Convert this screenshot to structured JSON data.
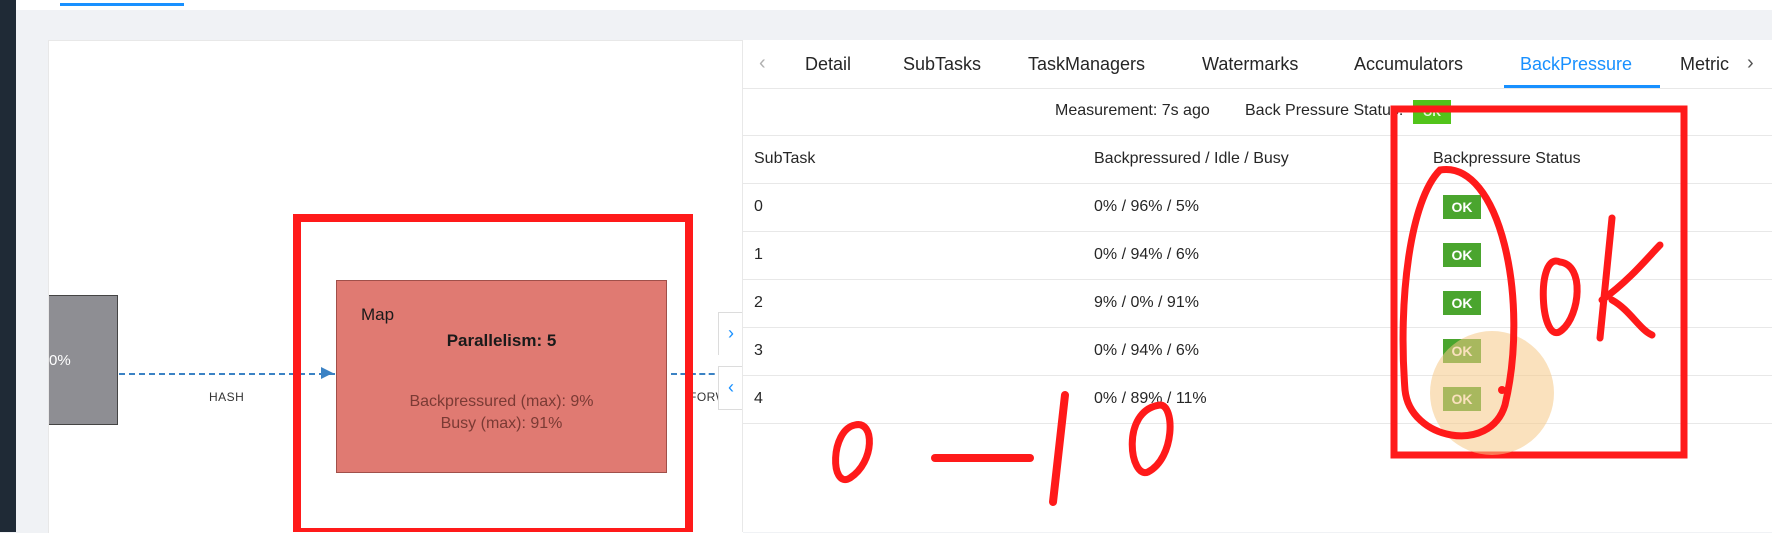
{
  "graph": {
    "source_node": {
      "percent": "0%"
    },
    "edges": {
      "left_label": "HASH",
      "right_label": "FORW"
    },
    "map_node": {
      "name": "Map",
      "parallelism": "Parallelism: 5",
      "backpressured": "Backpressured (max): 9%",
      "busy": "Busy (max): 91%"
    },
    "collapse_buttons": {
      "up": "›",
      "down": "‹"
    }
  },
  "tabs": {
    "prev_arrow": "‹",
    "next_arrow": "›",
    "items": [
      {
        "label": "Detail"
      },
      {
        "label": "SubTasks"
      },
      {
        "label": "TaskManagers"
      },
      {
        "label": "Watermarks"
      },
      {
        "label": "Accumulators"
      },
      {
        "label": "BackPressure",
        "active": true
      },
      {
        "label": "Metric"
      }
    ]
  },
  "measurement": {
    "text": "Measurement: 7s ago",
    "status_label": "Back Pressure Status:",
    "status_value": "OK"
  },
  "table": {
    "headers": [
      "SubTask",
      "Backpressured / Idle / Busy",
      "Backpressure Status"
    ],
    "rows": [
      {
        "subtask": "0",
        "ratio": "0% / 96% / 5%",
        "status": "OK"
      },
      {
        "subtask": "1",
        "ratio": "0% / 94% / 6%",
        "status": "OK"
      },
      {
        "subtask": "2",
        "ratio": "9% / 0% / 91%",
        "status": "OK"
      },
      {
        "subtask": "3",
        "ratio": "0% / 94% / 6%",
        "status": "OK"
      },
      {
        "subtask": "4",
        "ratio": "0% / 89% / 11%",
        "status": "OK"
      }
    ]
  },
  "annotations": {
    "handwriting_ok": "ok",
    "handwriting_range": "0—10"
  },
  "colors": {
    "accent": "#1890ff",
    "ok_badge": "#4aa52e",
    "map_node": "#e07a72",
    "annotation": "#ff1a1a"
  }
}
